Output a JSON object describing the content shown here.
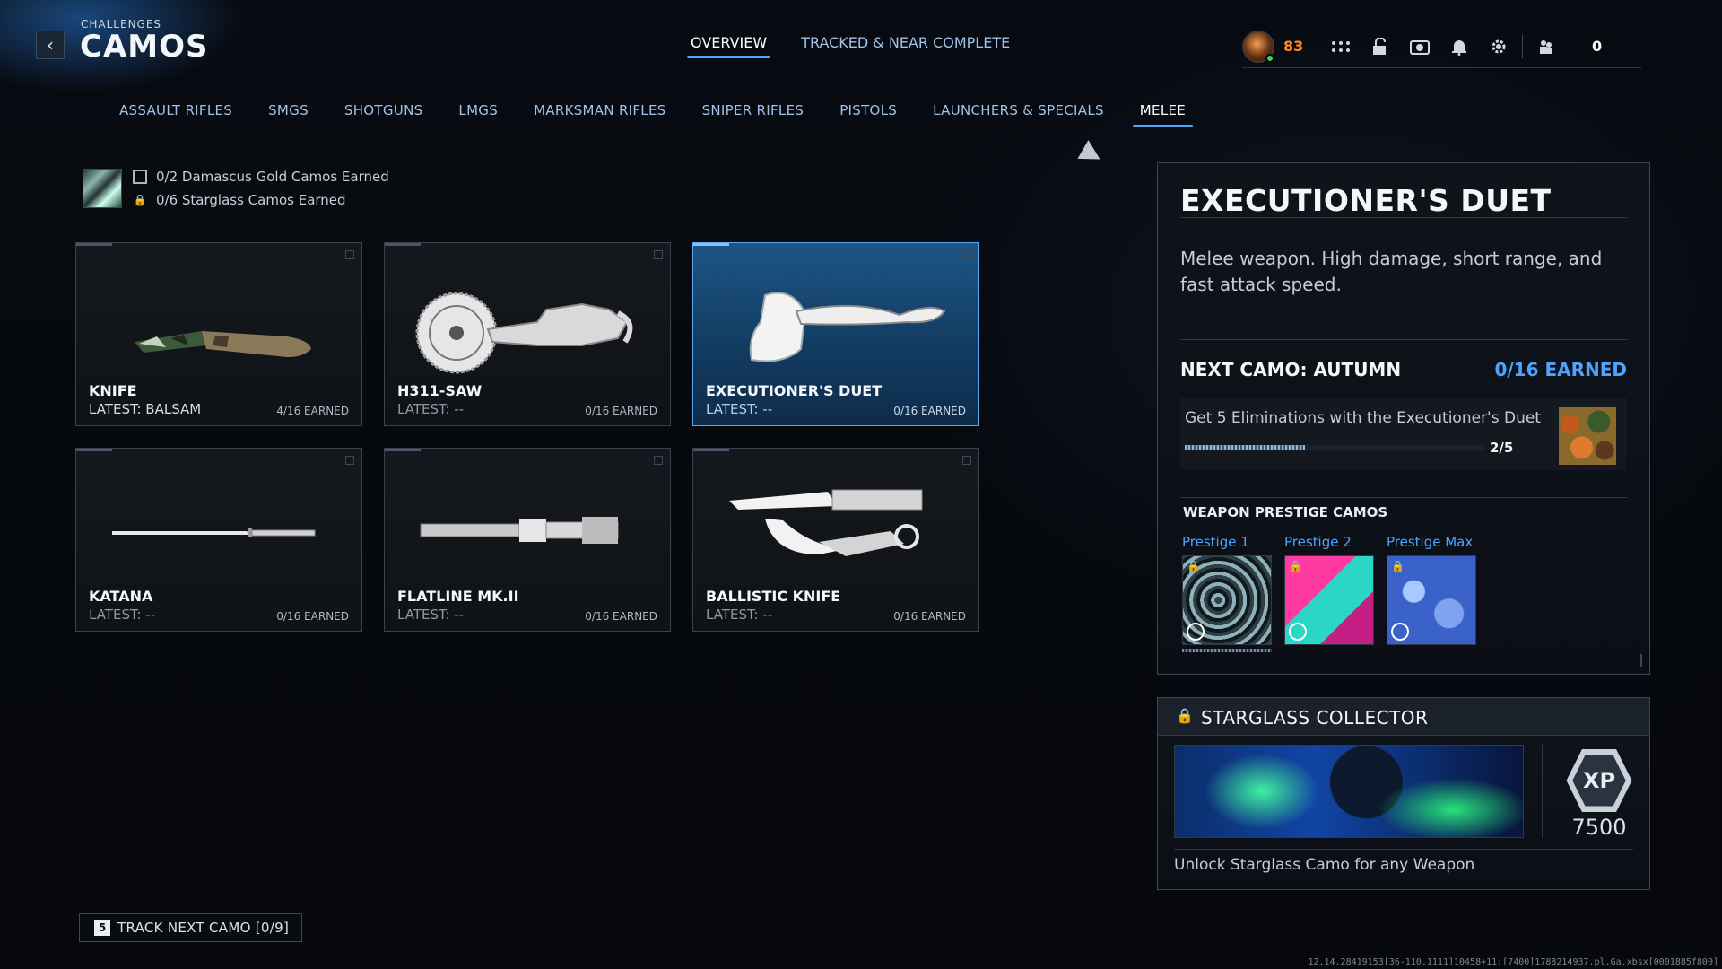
{
  "header": {
    "breadcrumb_small": "CHALLENGES",
    "title": "CAMOS",
    "back_icon": "chevron-left-icon"
  },
  "top_tabs": [
    {
      "label": "OVERVIEW",
      "active": true
    },
    {
      "label": "TRACKED & NEAR COMPLETE",
      "active": false
    }
  ],
  "hud": {
    "level": "83",
    "icons": [
      "grid-menu-icon",
      "unlock-icon",
      "camera-icon",
      "bell-icon",
      "gear-icon"
    ],
    "social_icon": "party-icon",
    "count": "0"
  },
  "category_tabs": [
    {
      "label": "ASSAULT RIFLES",
      "active": false
    },
    {
      "label": "SMGS",
      "active": false
    },
    {
      "label": "SHOTGUNS",
      "active": false
    },
    {
      "label": "LMGS",
      "active": false
    },
    {
      "label": "MARKSMAN RIFLES",
      "active": false
    },
    {
      "label": "SNIPER RIFLES",
      "active": false
    },
    {
      "label": "PISTOLS",
      "active": false
    },
    {
      "label": "LAUNCHERS & SPECIALS",
      "active": false
    },
    {
      "label": "MELEE",
      "active": true
    }
  ],
  "summary": {
    "line1": "0/2 Damascus Gold Camos Earned",
    "line2": "0/6 Starglass Camos Earned"
  },
  "weapons": [
    {
      "name": "KNIFE",
      "latest": "LATEST: BALSAM",
      "earned": "4/16 EARNED",
      "selected": false
    },
    {
      "name": "H311-SAW",
      "latest": "LATEST: --",
      "earned": "0/16 EARNED",
      "selected": false
    },
    {
      "name": "EXECUTIONER'S DUET",
      "latest": "LATEST: --",
      "earned": "0/16 EARNED",
      "selected": true
    },
    {
      "name": "KATANA",
      "latest": "LATEST: --",
      "earned": "0/16 EARNED",
      "selected": false
    },
    {
      "name": "FLATLINE MK.II",
      "latest": "LATEST: --",
      "earned": "0/16 EARNED",
      "selected": false
    },
    {
      "name": "BALLISTIC KNIFE",
      "latest": "LATEST: --",
      "earned": "0/16 EARNED",
      "selected": false
    }
  ],
  "details": {
    "title": "EXECUTIONER'S DUET",
    "description": "Melee weapon. High damage, short range, and fast attack speed.",
    "next_camo": "NEXT CAMO: AUTUMN",
    "next_earned": "0/16 EARNED",
    "challenge": "Get 5 Eliminations with the Executioner's Duet",
    "challenge_progress": "2/5",
    "challenge_fraction": 0.4,
    "prestige_header": "WEAPON PRESTIGE CAMOS",
    "prestige": [
      {
        "label": "Prestige 1"
      },
      {
        "label": "Prestige 2"
      },
      {
        "label": "Prestige Max"
      }
    ]
  },
  "collector": {
    "title": "STARGLASS COLLECTOR",
    "xp_label": "XP",
    "xp_amount": "7500",
    "description": "Unlock Starglass Camo for any Weapon"
  },
  "track": {
    "key": "5",
    "label": "TRACK NEXT CAMO [0/9]"
  },
  "build_string": "12.14.28419153[36-110.1111]10458+11:[7400]1788214937.pl.Ga.xbsx[0001885f800]",
  "colors": {
    "accent": "#4ea3ff",
    "level": "#ff8a2a",
    "selected_card": "#1d5585"
  }
}
